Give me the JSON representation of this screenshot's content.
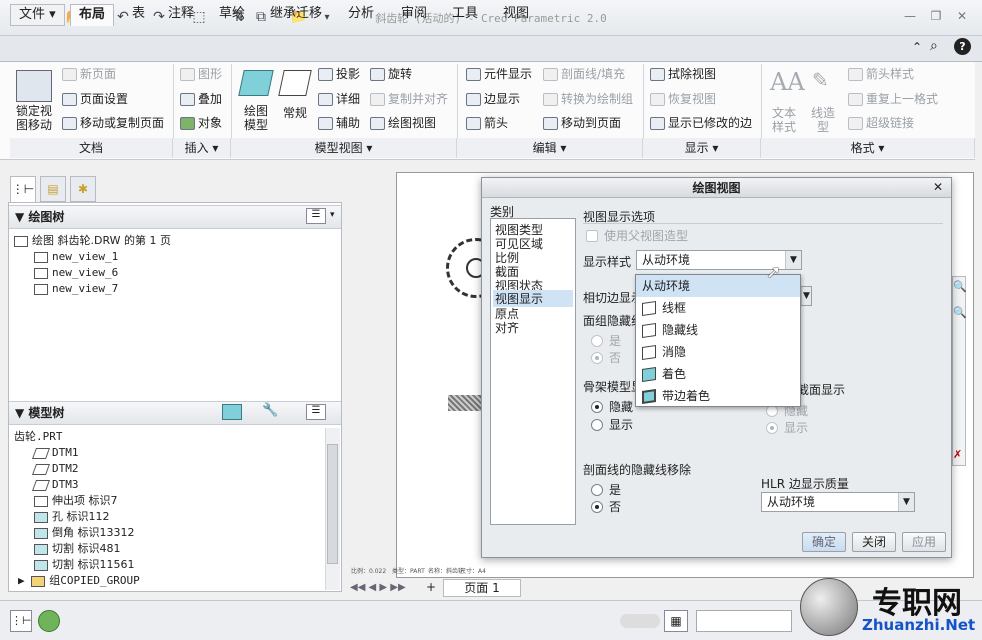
{
  "window": {
    "title": "斜齿轮 (活动的) - Creo Parametric 2.0",
    "minimize": "—",
    "restore": "❐",
    "close": "✕"
  },
  "tabs": [
    "文件 ▾",
    "布局",
    "表",
    "注释",
    "草绘",
    "继承迁移",
    "分析",
    "审阅",
    "工具",
    "视图"
  ],
  "ribbon": {
    "doc": {
      "big": "锁定视\n图移动",
      "items": [
        "新页面",
        "页面设置",
        "移动或复制页面"
      ],
      "group": "文档"
    },
    "insert": {
      "items": [
        "图形",
        "叠加",
        "对象"
      ],
      "group": "插入 ▾"
    },
    "model_view": {
      "big1": "绘图\n模型",
      "big2": "常规",
      "items": [
        "投影",
        "详细",
        "辅助",
        "旋转",
        "复制并对齐",
        "绘图视图"
      ],
      "group": "模型视图 ▾"
    },
    "edit": {
      "items": [
        "元件显示",
        "边显示",
        "箭头",
        "剖面线/填充",
        "转换为绘制组",
        "移动到页面"
      ],
      "group": "编辑 ▾"
    },
    "display": {
      "items": [
        "拭除视图",
        "恢复视图",
        "显示已修改的边"
      ],
      "group": "显示 ▾"
    },
    "format": {
      "big1": "文本\n样式",
      "big2": "线造\n型",
      "items": [
        "箭头样式",
        "重复上一格式",
        "超级链接"
      ],
      "group": "格式 ▾"
    }
  },
  "drawing_tree": {
    "title": "绘图树",
    "root": "绘图 斜齿轮.DRW 的第 1 页",
    "items": [
      "new_view_1",
      "new_view_6",
      "new_view_7"
    ]
  },
  "model_tree": {
    "title": "模型树",
    "root": "齿轮.PRT",
    "items": [
      "DTM1",
      "DTM2",
      "DTM3",
      "伸出项 标识7",
      "孔 标识112",
      "倒角 标识13312",
      "切割 标识481",
      "切割 标识11561",
      "组COPIED_GROUP"
    ]
  },
  "canvas": {
    "footer_left": "比例：0.022",
    "footer_mid": "类型：PART",
    "footer_mid2": "名称：斜齿轮",
    "footer_right": "尺寸：A4"
  },
  "page_nav": {
    "label": "页面 1",
    "add": "+"
  },
  "dialog": {
    "title": "绘图视图",
    "close": "✕",
    "category_label": "类别",
    "categories": [
      "视图类型",
      "可见区域",
      "比例",
      "截面",
      "视图状态",
      "视图显示",
      "原点",
      "对齐"
    ],
    "section_title": "视图显示选项",
    "use_parent": "使用父视图造型",
    "display_style_label": "显示样式",
    "display_style_value": "从动环境",
    "tangent_label": "相切边显示",
    "face_hidden_label": "面组隐藏线",
    "yes": "是",
    "no": "否",
    "skeleton_label": "骨架模型显示",
    "hide": "隐藏",
    "show": "显示",
    "right_yes": "是",
    "right_no": "否",
    "right_label": "焊件横截面显示",
    "xsec_label": "剖面线的隐藏线移除",
    "hlr_label": "HLR 边显示质量",
    "hlr_value": "从动环境",
    "options": [
      "从动环境",
      "线框",
      "隐藏线",
      "消隐",
      "着色",
      "带边着色"
    ],
    "ok": "确定",
    "close_btn": "关闭",
    "apply": "应用"
  },
  "watermark": {
    "brand": "专职网",
    "url": "Zhuanzhi.Net"
  }
}
